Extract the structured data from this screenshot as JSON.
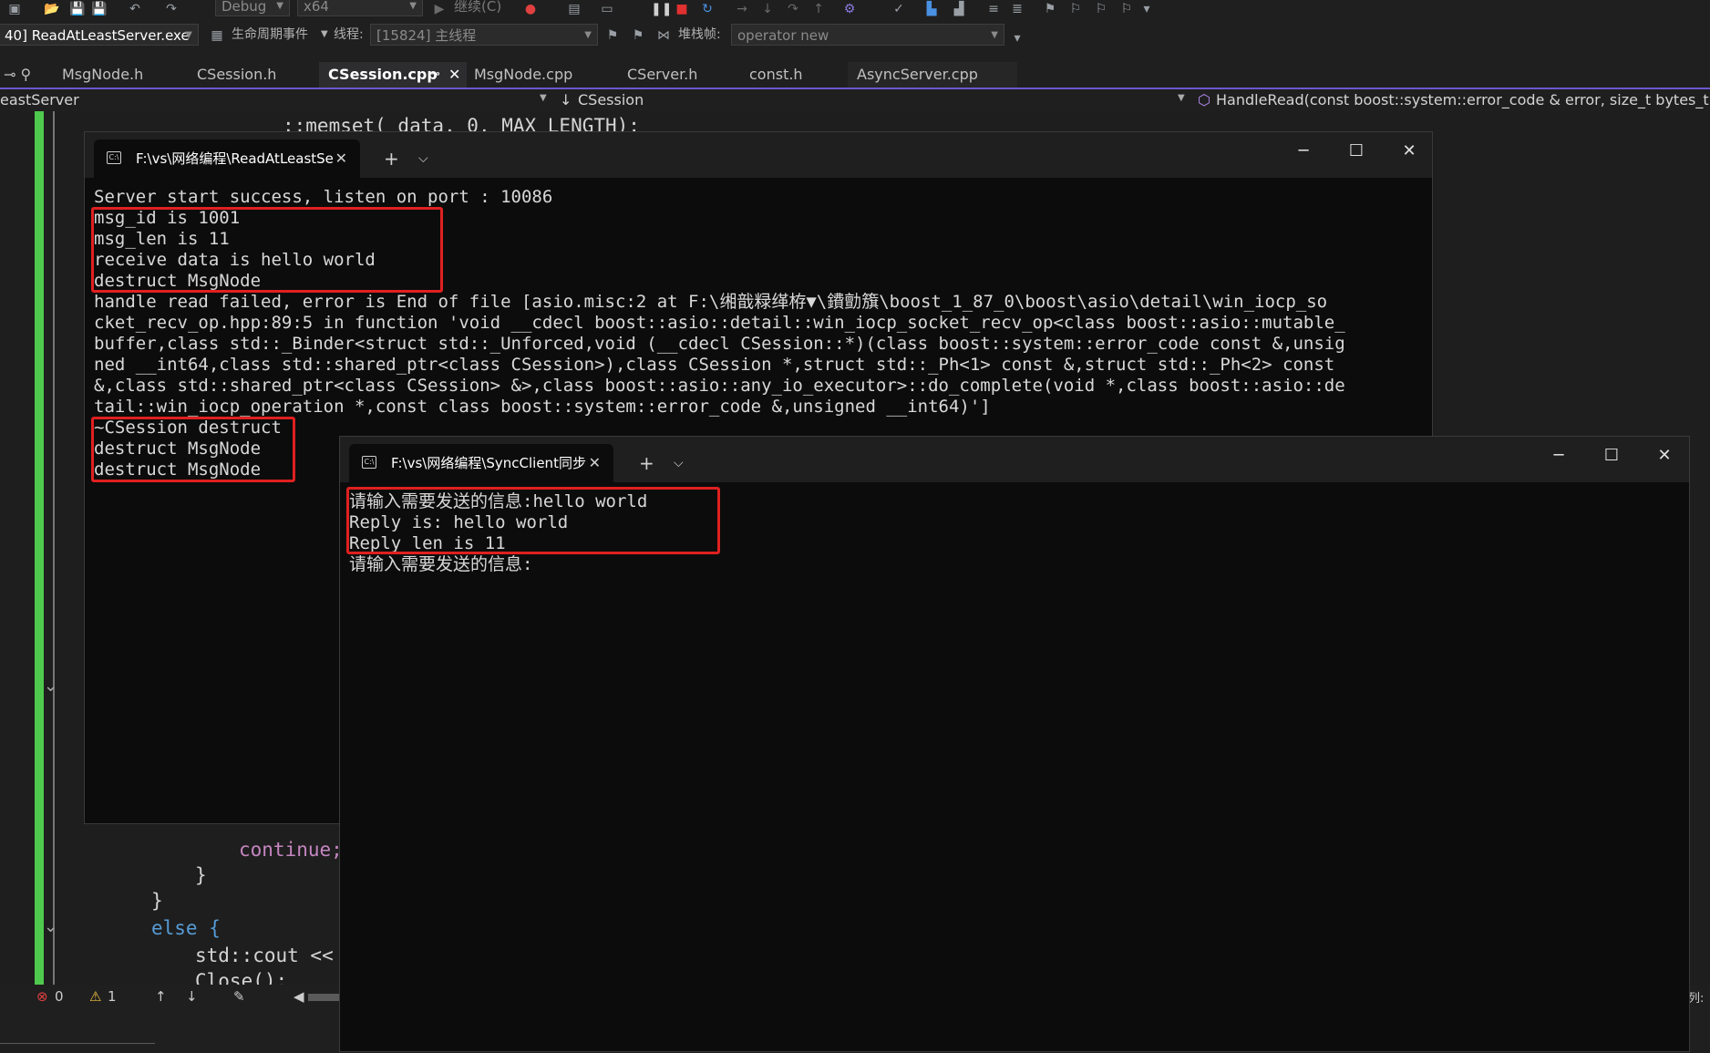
{
  "toolbar": {
    "config": "Debug",
    "platform": "x64",
    "continue_label": "继续(C)",
    "process": "40] ReadAtLeastServer.exe",
    "lifecycle_label": "生命周期事件",
    "thread_label": "线程:",
    "thread_value": "[15824] 主线程",
    "stackframe_label": "堆栈帧:",
    "stackframe_value": "operator new"
  },
  "tabs": [
    {
      "label": "MsgNode.h"
    },
    {
      "label": "CSession.h"
    },
    {
      "label": "CSession.cpp"
    },
    {
      "label": "MsgNode.cpp"
    },
    {
      "label": "CServer.h"
    },
    {
      "label": "const.h"
    },
    {
      "label": "AsyncServer.cpp"
    }
  ],
  "navbar": {
    "project": "eastServer",
    "class": "CSession",
    "member": "HandleRead(const boost::system::error_code & error, size_t bytes_transfer"
  },
  "code": {
    "line_top": "::memset( data, 0, MAX_LENGTH);",
    "line_continue": "continue;",
    "line_brace1": "}",
    "line_brace2": "}",
    "line_else": "else {",
    "line_cout": "std::cout <<",
    "line_close": "Close();"
  },
  "server_console": {
    "title": "F:\\vs\\网络编程\\ReadAtLeastSe",
    "lines": [
      "Server start success, listen on port : 10086",
      "msg_id is 1001",
      "msg_len is 11",
      "receive data is hello world",
      "destruct MsgNode",
      "handle read failed, error is End of file [asio.misc:2 at F:\\缃戠粶缂栫▼\\鐨勯籏\\boost_1_87_0\\boost\\asio\\detail\\win_iocp_so",
      "cket_recv_op.hpp:89:5 in function 'void __cdecl boost::asio::detail::win_iocp_socket_recv_op<class boost::asio::mutable_",
      "buffer,class std::_Binder<struct std::_Unforced,void (__cdecl CSession::*)(class boost::system::error_code const &,unsig",
      "ned __int64,class std::shared_ptr<class CSession>),class CSession *,struct std::_Ph<1> const &,struct std::_Ph<2> const",
      "&,class std::shared_ptr<class CSession> &>,class boost::asio::any_io_executor>::do_complete(void *,class boost::asio::de",
      "tail::win_iocp_operation *,const class boost::system::error_code &,unsigned __int64)']",
      "~CSession destruct",
      "destruct MsgNode",
      "destruct MsgNode"
    ]
  },
  "client_console": {
    "title": "F:\\vs\\网络编程\\SyncClient同步",
    "lines": [
      "请输入需要发送的信息:hello world",
      "Reply is: hello world",
      "Reply len is 11",
      "请输入需要发送的信息:"
    ]
  },
  "status": {
    "errors": "0",
    "warnings": "1",
    "col_label": "列:"
  },
  "colors": {
    "accent": "#6e56cf",
    "highlight_box": "#e02020",
    "console_bg": "#0c0c0c",
    "keyword": "#569cd6",
    "change_bar": "#4ec94e"
  }
}
